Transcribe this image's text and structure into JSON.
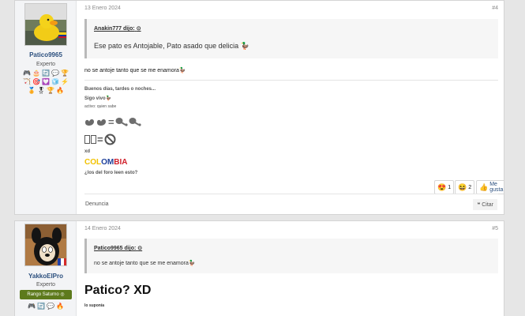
{
  "posts": [
    {
      "username": "Patico9965",
      "user_title": "Experto",
      "badges": [
        "🎮",
        "🎂",
        "🔄",
        "💬",
        "🏆",
        "🏹",
        "🎯",
        "💟",
        "🧊",
        "⚡",
        "🏅",
        "🎖",
        "🏆",
        "🔥"
      ],
      "date": "13 Enero 2024",
      "post_number": "#4",
      "quote": {
        "author": "Anakin777 dijo:",
        "text": "Ese pato es Antojable, Pato asado que delicia 🦆"
      },
      "message": "no se antoje tanto que se me enamora🦆",
      "signature": {
        "line1": "Buenos días, tardes o noches...",
        "line2": "Sigo vivo🦆",
        "line3": "activo: quien sabe",
        "duck_eq": "=",
        "line5": "xd",
        "colombia": [
          "COL",
          "OM",
          "BIA"
        ],
        "question": "¿los del foro leen esto?"
      },
      "reactions": [
        {
          "emoji": "😍",
          "count": "1"
        },
        {
          "emoji": "😆",
          "count": "2"
        }
      ],
      "like_label": "Me gusta",
      "report_label": "Denuncia",
      "quote_label": "Citar"
    },
    {
      "username": "YakkoElPro",
      "user_title": "Experto",
      "rank_badge": "Rango Saturno ◎",
      "badges": [
        "🎮",
        "🔄",
        "💬",
        "🔥"
      ],
      "date": "14 Enero 2024",
      "post_number": "#5",
      "quote": {
        "author": "Patico9965 dijo:",
        "text": "no se antoje tanto que se me enamora🦆"
      },
      "heading": "Patico? XD",
      "small_text": "lo suponía"
    }
  ]
}
